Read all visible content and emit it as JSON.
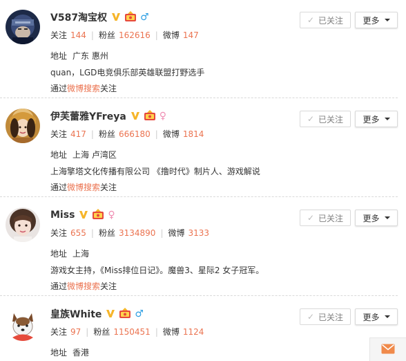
{
  "labels": {
    "following": "关注",
    "fans": "粉丝",
    "posts": "微博",
    "address": "地址",
    "via": "通过",
    "via_link": "微博搜索",
    "via_suffix": "关注",
    "followed_button": "已关注",
    "more_button": "更多"
  },
  "users": [
    {
      "name": "V587淘宝权",
      "gender": "male",
      "gender_symbol": "♂",
      "following": "144",
      "fans": "162616",
      "posts": "147",
      "address": "广东 惠州",
      "bio": "quan，LGD电竞俱乐部英雄联盟打野选手"
    },
    {
      "name": "伊芙蕾雅YFreya",
      "gender": "female",
      "gender_symbol": "♀",
      "following": "417",
      "fans": "666180",
      "posts": "1814",
      "address": "上海 卢湾区",
      "bio": "上海擎塔文化传播有限公司 《撸时代》制片人、游戏解说"
    },
    {
      "name": "Miss",
      "gender": "female",
      "gender_symbol": "♀",
      "following": "655",
      "fans": "3134890",
      "posts": "3133",
      "address": "上海",
      "bio": "游戏女主持，《Miss排位日记》。魔兽3、星际2 女子冠军。"
    },
    {
      "name": "皇族White",
      "gender": "male",
      "gender_symbol": "♂",
      "following": "97",
      "fans": "1150451",
      "posts": "1124",
      "address": "香港",
      "bio": ""
    }
  ],
  "colors": {
    "accent": "#eb7350",
    "verified": "#f6b52a",
    "male": "#2e9fe3",
    "female": "#f08fb4",
    "separator": "#d9d9d9"
  },
  "icons": {
    "verified": "verified-v-icon",
    "club": "club-member-icon",
    "message": "mail-icon",
    "check": "check-icon",
    "more": "caret-down-icon"
  }
}
